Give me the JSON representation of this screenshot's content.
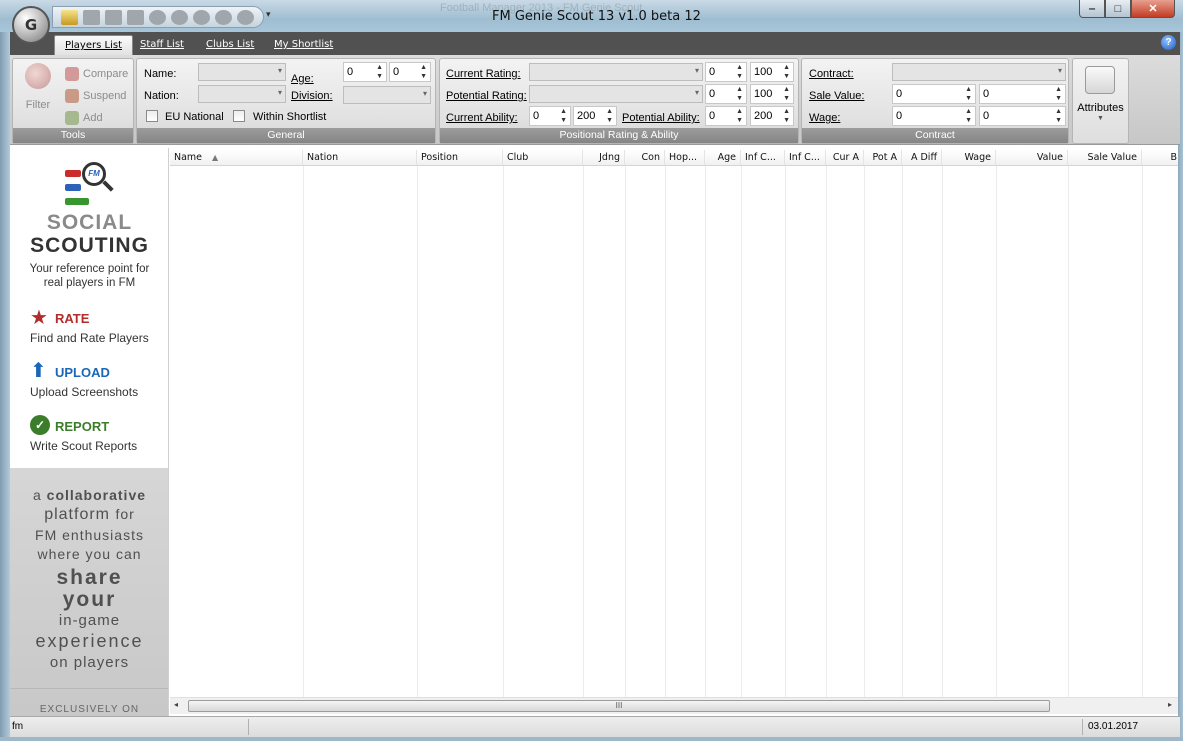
{
  "window": {
    "title": "FM Genie Scout 13 v1.0 beta 12",
    "background_text": "Football Manager 2013 - FM Genie Scout",
    "controls": {
      "minimize": "‒",
      "maximize": "□",
      "close": "✕"
    }
  },
  "tabs": [
    {
      "label": "Players List",
      "active": true
    },
    {
      "label": "Staff List",
      "active": false
    },
    {
      "label": "Clubs List",
      "active": false
    },
    {
      "label": "My Shortlist",
      "active": false
    }
  ],
  "help": {
    "label": "?"
  },
  "ribbon": {
    "tools": {
      "caption": "Tools",
      "filter_label": "Filter",
      "compare_label": "Compare",
      "suspend_label": "Suspend",
      "add_label": "Add"
    },
    "general": {
      "caption": "General",
      "name_label": "Name:",
      "nation_label": "Nation:",
      "age_label": "Age:",
      "division_label": "Division:",
      "age_min": "0",
      "age_max": "0",
      "eu_national_label": "EU National",
      "within_shortlist_label": "Within Shortlist"
    },
    "positional": {
      "caption": "Positional Rating & Ability",
      "current_rating_label": "Current Rating:",
      "potential_rating_label": "Potential Rating:",
      "current_ability_label": "Current Ability:",
      "potential_ability_label": "Potential Ability:",
      "cr_min": "0",
      "cr_max": "100",
      "pr_min": "0",
      "pr_max": "100",
      "ca_min": "0",
      "ca_max": "200",
      "pa_min": "0",
      "pa_max": "200"
    },
    "contract": {
      "caption": "Contract",
      "contract_label": "Contract:",
      "sale_value_label": "Sale Value:",
      "wage_label": "Wage:",
      "sv_min": "0",
      "sv_max": "0",
      "wage_min": "0",
      "wage_max": "0"
    },
    "attributes_label": "Attributes"
  },
  "sidebar": {
    "title_line1": "SOCIAL",
    "title_line2": "SCOUTING",
    "subtitle": "Your reference point for real players in FM",
    "fm_badge": "FM",
    "rate_title": "RATE",
    "rate_desc": "Find and Rate Players",
    "upload_title": "UPLOAD",
    "upload_desc": "Upload Screenshots",
    "report_title": "REPORT",
    "report_desc": "Write Scout Reports",
    "promo": {
      "l1a": "a",
      "l1b": "collaborative",
      "l2a": "platform",
      "l2b": "for",
      "l3": "FM enthusiasts",
      "l4": "where you can",
      "l5": "share",
      "l6": "your",
      "l7": "in-game",
      "l8": "experience",
      "l9": "on players",
      "exclusive": "EXCLUSIVELY ON"
    }
  },
  "columns": [
    "Name",
    "Nation",
    "Position",
    "Club",
    "Jdng",
    "Con",
    "Hop...",
    "Age",
    "Inf C...",
    "Inf C...",
    "Cur A",
    "Pot A",
    "A Diff",
    "Wage",
    "Value",
    "Sale Value",
    "B"
  ],
  "scrollbar_grip": "III",
  "status": {
    "left": "fm",
    "date": "03.01.2017"
  }
}
